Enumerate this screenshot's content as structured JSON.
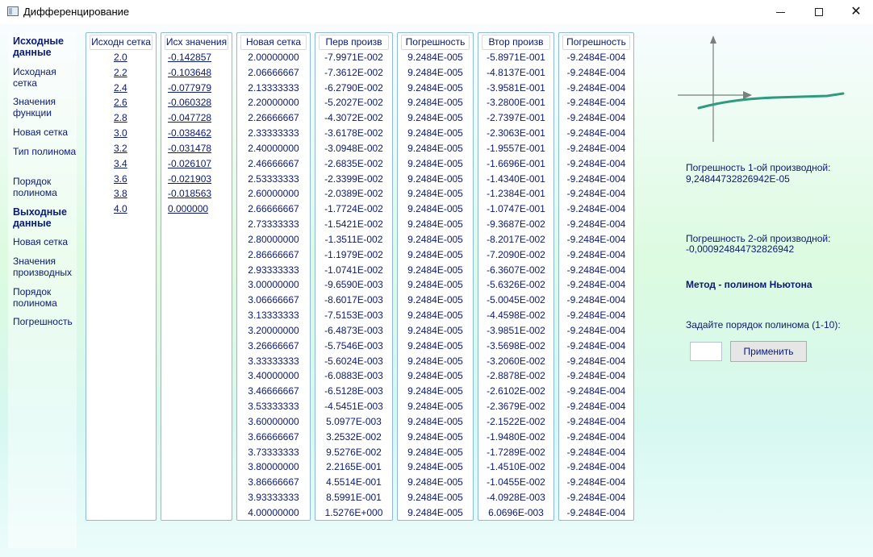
{
  "window": {
    "title": "Дифференцирование"
  },
  "sidebar": [
    {
      "label": "Исходные данные",
      "head": true
    },
    {
      "label": "Исходная сетка",
      "head": false
    },
    {
      "label": "Значения функции",
      "head": false
    },
    {
      "label": "Новая сетка",
      "head": false
    },
    {
      "label": "Тип полинома",
      "head": false
    },
    {
      "label": "Порядок полинома",
      "head": false
    },
    {
      "label": "Выходные данные",
      "head": true
    },
    {
      "label": "Новая сетка",
      "head": false
    },
    {
      "label": "Значения производных",
      "head": false
    },
    {
      "label": "Порядок полинома",
      "head": false
    },
    {
      "label": "Погрешность",
      "head": false
    }
  ],
  "columns": [
    {
      "header": "Исходн сетка",
      "style": "link l1",
      "values": [
        "2.0",
        "2.2",
        "2.4",
        "2.6",
        "2.8",
        "3.0",
        "3.2",
        "3.4",
        "3.6",
        "3.8",
        "4.0"
      ]
    },
    {
      "header": "Исх значения",
      "style": "link l2",
      "values": [
        "-0.142857",
        "-0.103648",
        "-0.077979",
        "-0.060328",
        "-0.047728",
        "-0.038462",
        "-0.031478",
        "-0.026107",
        "-0.021903",
        "-0.018563",
        "0.000000"
      ]
    },
    {
      "header": "Новая сетка",
      "style": "",
      "values": [
        "2.00000000",
        "2.06666667",
        "2.13333333",
        "2.20000000",
        "2.26666667",
        "2.33333333",
        "2.40000000",
        "2.46666667",
        "2.53333333",
        "2.60000000",
        "2.66666667",
        "2.73333333",
        "2.80000000",
        "2.86666667",
        "2.93333333",
        "3.00000000",
        "3.06666667",
        "3.13333333",
        "3.20000000",
        "3.26666667",
        "3.33333333",
        "3.40000000",
        "3.46666667",
        "3.53333333",
        "3.60000000",
        "3.66666667",
        "3.73333333",
        "3.80000000",
        "3.86666667",
        "3.93333333",
        "4.00000000"
      ]
    },
    {
      "header": "Перв произв",
      "style": "",
      "values": [
        "-7.9971E-002",
        "-7.3612E-002",
        "-6.2790E-002",
        "-5.2027E-002",
        "-4.3072E-002",
        "-3.6178E-002",
        "-3.0948E-002",
        "-2.6835E-002",
        "-2.3399E-002",
        "-2.0389E-002",
        "-1.7724E-002",
        "-1.5421E-002",
        "-1.3511E-002",
        "-1.1979E-002",
        "-1.0741E-002",
        "-9.6590E-003",
        "-8.6017E-003",
        "-7.5153E-003",
        "-6.4873E-003",
        "-5.7546E-003",
        "-5.6024E-003",
        "-6.0883E-003",
        "-6.5128E-003",
        "-4.5451E-003",
        "5.0977E-003",
        "3.2532E-002",
        "9.5276E-002",
        "2.2165E-001",
        "4.5514E-001",
        "8.5991E-001",
        "1.5276E+000"
      ]
    },
    {
      "header": "Погрешность",
      "style": "",
      "values": [
        "9.2484E-005",
        "9.2484E-005",
        "9.2484E-005",
        "9.2484E-005",
        "9.2484E-005",
        "9.2484E-005",
        "9.2484E-005",
        "9.2484E-005",
        "9.2484E-005",
        "9.2484E-005",
        "9.2484E-005",
        "9.2484E-005",
        "9.2484E-005",
        "9.2484E-005",
        "9.2484E-005",
        "9.2484E-005",
        "9.2484E-005",
        "9.2484E-005",
        "9.2484E-005",
        "9.2484E-005",
        "9.2484E-005",
        "9.2484E-005",
        "9.2484E-005",
        "9.2484E-005",
        "9.2484E-005",
        "9.2484E-005",
        "9.2484E-005",
        "9.2484E-005",
        "9.2484E-005",
        "9.2484E-005",
        "9.2484E-005"
      ]
    },
    {
      "header": "Втор произв",
      "style": "",
      "values": [
        "-5.8971E-001",
        "-4.8137E-001",
        "-3.9581E-001",
        "-3.2800E-001",
        "-2.7397E-001",
        "-2.3063E-001",
        "-1.9557E-001",
        "-1.6696E-001",
        "-1.4340E-001",
        "-1.2384E-001",
        "-1.0747E-001",
        "-9.3687E-002",
        "-8.2017E-002",
        "-7.2090E-002",
        "-6.3607E-002",
        "-5.6326E-002",
        "-5.0045E-002",
        "-4.4598E-002",
        "-3.9851E-002",
        "-3.5698E-002",
        "-3.2060E-002",
        "-2.8878E-002",
        "-2.6102E-002",
        "-2.3679E-002",
        "-2.1522E-002",
        "-1.9480E-002",
        "-1.7289E-002",
        "-1.4510E-002",
        "-1.0455E-002",
        "-4.0928E-003",
        "6.0696E-003"
      ]
    },
    {
      "header": "Погрешность",
      "style": "",
      "values": [
        "-9.2484E-004",
        "-9.2484E-004",
        "-9.2484E-004",
        "-9.2484E-004",
        "-9.2484E-004",
        "-9.2484E-004",
        "-9.2484E-004",
        "-9.2484E-004",
        "-9.2484E-004",
        "-9.2484E-004",
        "-9.2484E-004",
        "-9.2484E-004",
        "-9.2484E-004",
        "-9.2484E-004",
        "-9.2484E-004",
        "-9.2484E-004",
        "-9.2484E-004",
        "-9.2484E-004",
        "-9.2484E-004",
        "-9.2484E-004",
        "-9.2484E-004",
        "-9.2484E-004",
        "-9.2484E-004",
        "-9.2484E-004",
        "-9.2484E-004",
        "-9.2484E-004",
        "-9.2484E-004",
        "-9.2484E-004",
        "-9.2484E-004",
        "-9.2484E-004",
        "-9.2484E-004"
      ]
    }
  ],
  "info": {
    "err1_label": "Погрешность 1-ой производной:",
    "err1_value": "9,24844732826942E-05",
    "err2_label": "Погрешность 2-ой производной:",
    "err2_value": "-0,000924844732826942",
    "method": "Метод - полином Ньютона",
    "order_prompt": "Задайте порядок полинома (1-10):",
    "order_value": "",
    "apply_label": "Применить"
  },
  "colors": {
    "text": "#0b1a73",
    "curve": "#2e9a7e",
    "border": "#8fb8e2"
  }
}
